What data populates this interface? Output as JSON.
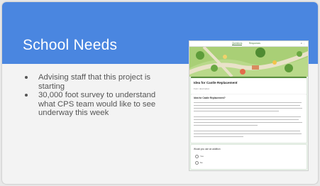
{
  "slide": {
    "title": "School Needs",
    "bullets": [
      "Advising staff that this project is starting",
      "30,000 foot survey to understand what CPS team would like to see underway this week"
    ]
  },
  "form": {
    "tabs": [
      "Questions",
      "Responses"
    ],
    "title": "Idea for Castle Replacement",
    "subtitle": "Form description",
    "section_heading": "Idea for Castle Replacement?",
    "question": "Would you use an addition",
    "options": [
      "Yes",
      "No"
    ]
  },
  "colors": {
    "accent": "#4a86e0",
    "form_accent": "#5a8f3e"
  }
}
